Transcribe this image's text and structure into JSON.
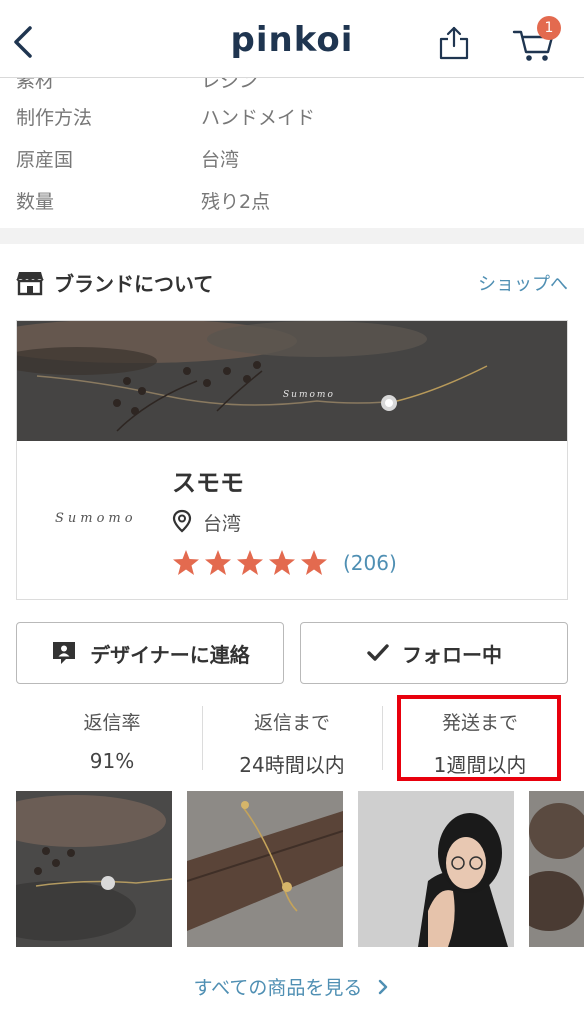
{
  "header": {
    "logo": "pinkoi",
    "cart_count": "1"
  },
  "specs": [
    {
      "label": "素材",
      "value": "レジン"
    },
    {
      "label": "制作方法",
      "value": "ハンドメイド"
    },
    {
      "label": "原産国",
      "value": "台湾"
    },
    {
      "label": "数量",
      "value": "残り2点"
    }
  ],
  "brand": {
    "section_title": "ブランドについて",
    "shop_link": "ショップへ",
    "logo_text": "Sumomo",
    "name": "スモモ",
    "location": "台湾",
    "stars": 5,
    "review_count": "(206)"
  },
  "buttons": {
    "contact": "デザイナーに連絡",
    "follow": "フォロー中"
  },
  "stats": [
    {
      "label": "返信率",
      "value": "91%"
    },
    {
      "label": "返信まで",
      "value": "24時間以内"
    },
    {
      "label": "発送まで",
      "value": "1週間以内"
    }
  ],
  "see_all": "すべての商品を見る",
  "colors": {
    "brand_navy": "#1f3550",
    "link_blue": "#4f8fb3",
    "star": "#e36a4f",
    "highlight": "#e8000d"
  }
}
